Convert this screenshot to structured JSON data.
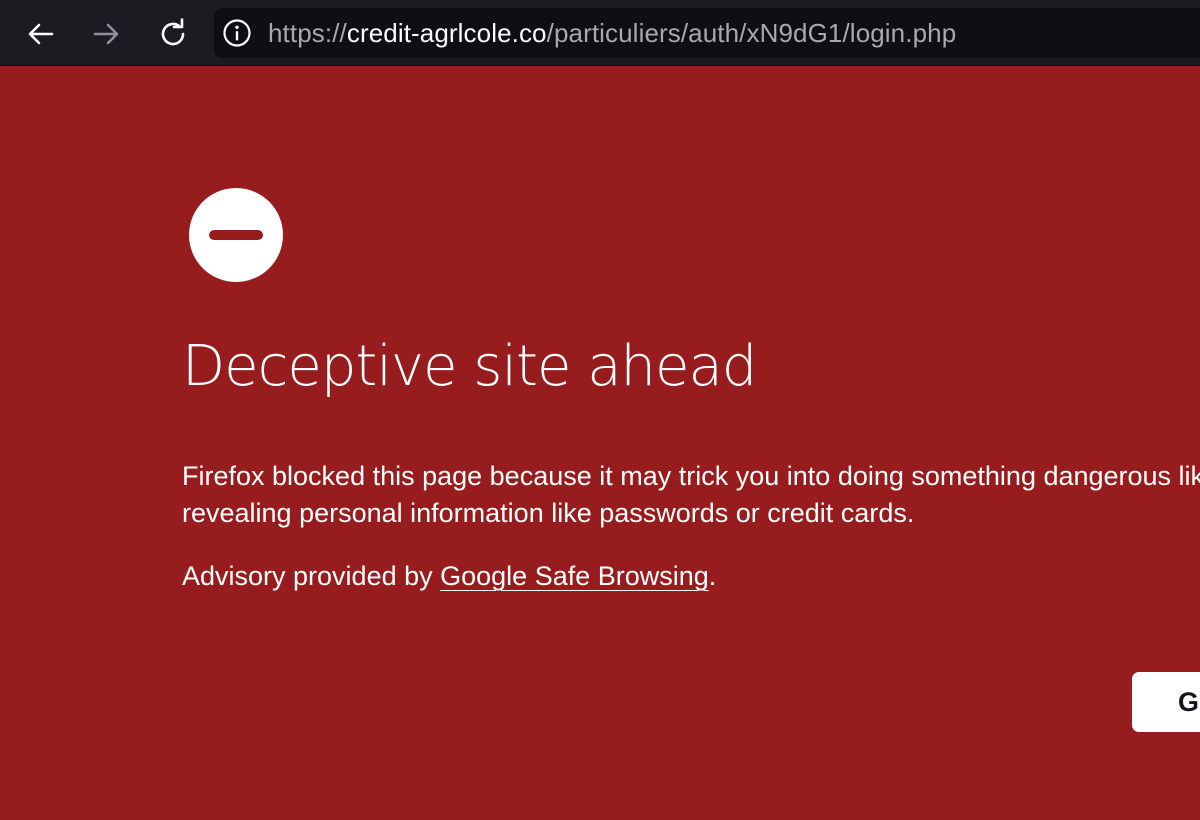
{
  "browser": {
    "url_prefix": "https://",
    "url_host": "credit-agrlcole.co",
    "url_path": "/particuliers/auth/xN9dG1/login.php",
    "icons": {
      "back": "back-arrow-icon",
      "forward": "forward-arrow-icon",
      "reload": "reload-icon",
      "site_info": "info-icon"
    }
  },
  "page": {
    "icon": "blocked-minus-circle-icon",
    "title": "Deceptive site ahead",
    "description_line1": "Firefox blocked this page because it may trick you into doing something dangerous like installing software or",
    "description_line2": "revealing personal information like passwords or credit cards.",
    "advisory_prefix": "Advisory provided by ",
    "advisory_link": "Google Safe Browsing",
    "advisory_suffix": ".",
    "go_back_label": "Go back"
  },
  "colors": {
    "background": "#971c1e",
    "toolbar": "#1c1b22",
    "urlbar": "#0f0e13",
    "text": "#ffffff",
    "button": "#ffffff"
  }
}
